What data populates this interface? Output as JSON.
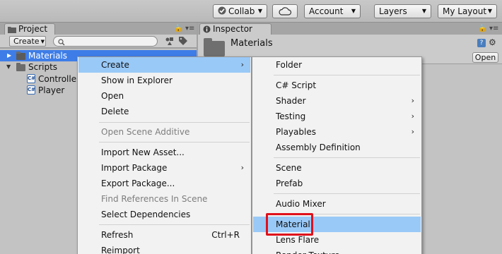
{
  "toolbar": {
    "collab_label": "Collab",
    "account_label": "Account",
    "layers_label": "Layers",
    "layout_label": "My Layout"
  },
  "project": {
    "tab_label": "Project",
    "create_label": "Create",
    "search_placeholder": "",
    "tree": [
      {
        "label": "Materials",
        "selected": true
      },
      {
        "label": "Scripts"
      },
      {
        "label": "Controller"
      },
      {
        "label": "Player"
      }
    ]
  },
  "inspector": {
    "tab_label": "Inspector",
    "title": "Materials",
    "open_label": "Open"
  },
  "context_menu": {
    "items": [
      {
        "label": "Create",
        "submenu": true,
        "highlighted": true
      },
      {
        "label": "Show in Explorer"
      },
      {
        "label": "Open"
      },
      {
        "label": "Delete"
      },
      {
        "label": "Open Scene Additive",
        "disabled": true
      },
      {
        "label": "Import New Asset..."
      },
      {
        "label": "Import Package",
        "submenu": true
      },
      {
        "label": "Export Package..."
      },
      {
        "label": "Find References In Scene",
        "disabled": true
      },
      {
        "label": "Select Dependencies"
      },
      {
        "label": "Refresh",
        "shortcut": "Ctrl+R"
      },
      {
        "label": "Reimport"
      }
    ]
  },
  "create_submenu": {
    "items": [
      {
        "label": "Folder"
      },
      {
        "label": "C# Script"
      },
      {
        "label": "Shader",
        "submenu": true
      },
      {
        "label": "Testing",
        "submenu": true
      },
      {
        "label": "Playables",
        "submenu": true
      },
      {
        "label": "Assembly Definition"
      },
      {
        "label": "Scene"
      },
      {
        "label": "Prefab"
      },
      {
        "label": "Audio Mixer"
      },
      {
        "label": "Material",
        "highlighted": true
      },
      {
        "label": "Lens Flare"
      },
      {
        "label": "Render Texture"
      }
    ]
  },
  "colors": {
    "selection_blue": "#3e7de7",
    "menu_highlight": "#99c9f7",
    "callout_red": "#e0101b"
  }
}
